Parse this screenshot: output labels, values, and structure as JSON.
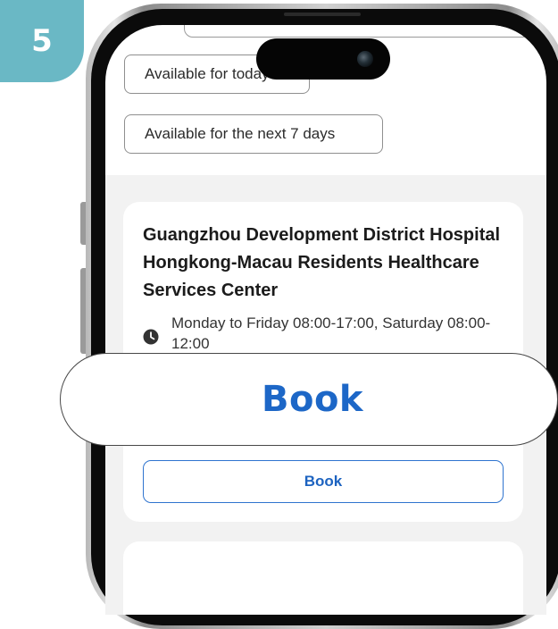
{
  "step_badge": {
    "number": "5",
    "color": "#6ab8c5"
  },
  "filters": {
    "chips": [
      {
        "label": "Available for today"
      },
      {
        "label": "Available for the next 7 days"
      }
    ]
  },
  "results": {
    "cards": [
      {
        "title": "Guangzhou Development District Hospital Hongkong-Macau Residents Healthcare Services Center",
        "hours_icon": "clock-icon",
        "hours": "Monday to Friday 08:00-17:00, Saturday 08:00-12:00",
        "book_label": "Book"
      }
    ]
  },
  "callout": {
    "label": "Book",
    "accent_color": "#1d67c7"
  }
}
